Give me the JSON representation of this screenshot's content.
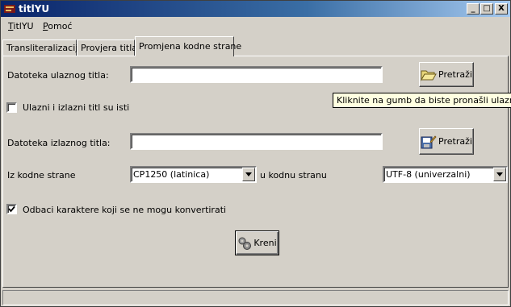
{
  "window": {
    "title": "titlYU",
    "controls": {
      "minimize": "_",
      "maximize": "□",
      "close": "X"
    }
  },
  "menu": {
    "items": [
      {
        "underline": "T",
        "rest": "itlYU"
      },
      {
        "underline": "P",
        "rest": "omoć"
      }
    ]
  },
  "tabs": [
    {
      "label": "Transliteralizacija",
      "active": false
    },
    {
      "label": "Provjera titla",
      "active": false
    },
    {
      "label": "Promjena kodne strane",
      "active": true
    }
  ],
  "form": {
    "input_file_label": "Datoteka ulaznog titla:",
    "input_file_value": "",
    "browse_input_label": "Pretraži",
    "same_checkbox_label": "Ulazni i izlazni titl su isti",
    "same_checkbox_checked": false,
    "output_file_label": "Datoteka izlaznog titla:",
    "output_file_value": "",
    "browse_output_label": "Pretraži",
    "from_codepage_label": "Iz kodne strane",
    "from_codepage_value": "CP1250 (latinica)",
    "to_codepage_label": "u kodnu stranu",
    "to_codepage_value": "UTF-8 (univerzalni)",
    "discard_checkbox_label": "Odbaci karaktere koji se ne mogu konvertirati",
    "discard_checkbox_checked": true,
    "go_button_label": "Kreni"
  },
  "tooltip": {
    "text": "Kliknite na gumb da biste pronašli ulazni titl"
  },
  "status": {
    "text": ""
  }
}
